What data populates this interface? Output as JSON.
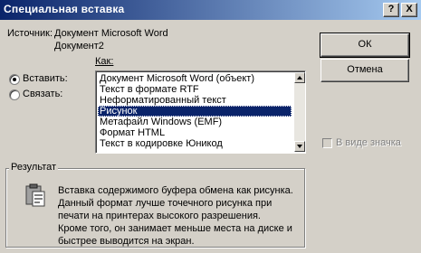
{
  "window": {
    "title": "Специальная вставка",
    "help_button": "?",
    "close_button": "X"
  },
  "source": {
    "label": "Источник:",
    "line1": "Документ Microsoft Word",
    "line2": "Документ2"
  },
  "as_label": "Как:",
  "paste_options": {
    "paste": "Вставить:",
    "paste_link": "Связать:",
    "selected": "paste"
  },
  "formats": [
    "Документ Microsoft Word (объект)",
    "Текст в формате RTF",
    "Неформатированный текст",
    "Рисунок",
    "Метафайл Windows (EMF)",
    "Формат HTML",
    "Текст в кодировке Юникод"
  ],
  "selected_format": "Рисунок",
  "buttons": {
    "ok": "ОК",
    "cancel": "Отмена"
  },
  "display_as_icon": {
    "label": "В виде значка",
    "checked": false,
    "enabled": false
  },
  "result": {
    "label": "Результат",
    "lines": [
      "Вставка содержимого буфера обмена как рисунка.",
      "Данный формат лучше точечного рисунка при",
      "печати на принтерах высокого разрешения.",
      "Кроме того, он занимает меньше места на диске и",
      "быстрее выводится на экран."
    ]
  },
  "colors": {
    "title_bar_start": "#0a246a",
    "title_bar_end": "#a6caf0",
    "selection": "#0a246a",
    "face": "#d4d0c8"
  },
  "icons": {
    "result_icon": "clipboard-icon"
  }
}
